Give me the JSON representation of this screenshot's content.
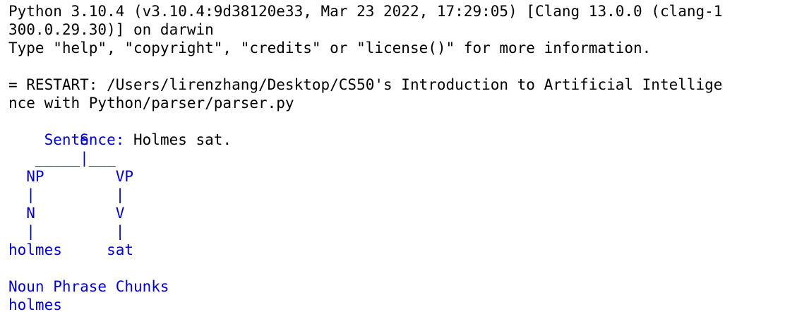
{
  "colors": {
    "stdout": "#0000cc",
    "text": "#000000",
    "background": "#ffffff"
  },
  "shell": {
    "banner": [
      "Python 3.10.4 (v3.10.4:9d38120e33, Mar 23 2022, 17:29:05) [Clang 13.0.0 (clang-1",
      "300.0.29.30)] on darwin",
      "Type \"help\", \"copyright\", \"credits\" or \"license()\" for more information."
    ],
    "restart": [
      "= RESTART: /Users/lirenzhang/Desktop/CS50's Introduction to Artificial Intellige",
      "nce with Python/parser/parser.py"
    ],
    "prompt": {
      "label": "Sentence:",
      "input": " Holmes sat."
    },
    "tree": [
      "        S",
      "   _____|___",
      "  NP        VP",
      "  |         |",
      "  N         V",
      "  |         |",
      "holmes     sat"
    ],
    "chunks_header": "Noun Phrase Chunks",
    "chunks": [
      "holmes"
    ]
  }
}
